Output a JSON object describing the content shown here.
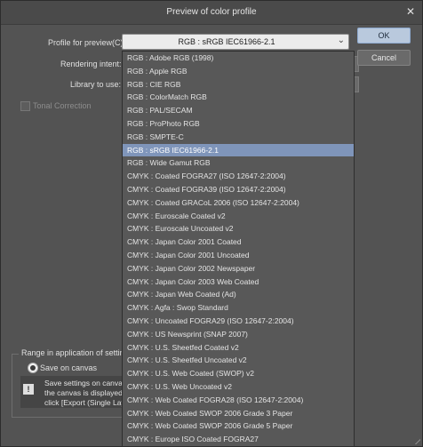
{
  "window": {
    "title": "Preview of color profile"
  },
  "form": {
    "profile_label": "Profile for preview(C):",
    "rendering_label": "Rendering intent:",
    "library_label": "Library to use:",
    "tonal_label": "Tonal Correction",
    "selected_profile": "RGB : sRGB IEC61966-2.1"
  },
  "buttons": {
    "ok": "OK",
    "cancel": "Cancel"
  },
  "range": {
    "title": "Range in application of settings",
    "radio_label": "Save on canvas",
    "info_lines": [
      "Save settings on canvas",
      "the canvas is displayed.",
      "click [Export (Single Laye"
    ]
  },
  "dropdown_options": [
    "RGB : Adobe RGB (1998)",
    "RGB : Apple RGB",
    "RGB : CIE RGB",
    "RGB : ColorMatch RGB",
    "RGB : PAL/SECAM",
    "RGB : ProPhoto RGB",
    "RGB : SMPTE-C",
    "RGB : sRGB IEC61966-2.1",
    "RGB : Wide Gamut RGB",
    "CMYK : Coated FOGRA27 (ISO 12647-2:2004)",
    "CMYK : Coated FOGRA39 (ISO 12647-2:2004)",
    "CMYK : Coated GRACoL 2006 (ISO 12647-2:2004)",
    "CMYK : Euroscale Coated v2",
    "CMYK : Euroscale Uncoated v2",
    "CMYK : Japan Color 2001 Coated",
    "CMYK : Japan Color 2001 Uncoated",
    "CMYK : Japan Color 2002 Newspaper",
    "CMYK : Japan Color 2003 Web Coated",
    "CMYK : Japan Web Coated (Ad)",
    "CMYK : Agfa : Swop Standard",
    "CMYK : Uncoated FOGRA29 (ISO 12647-2:2004)",
    "CMYK : US Newsprint (SNAP 2007)",
    "CMYK : U.S. Sheetfed Coated v2",
    "CMYK : U.S. Sheetfed Uncoated v2",
    "CMYK : U.S. Web Coated (SWOP) v2",
    "CMYK : U.S. Web Uncoated v2",
    "CMYK : Web Coated FOGRA28 (ISO 12647-2:2004)",
    "CMYK : Web Coated SWOP 2006 Grade 3 Paper",
    "CMYK : Web Coated SWOP 2006 Grade 5 Paper",
    "CMYK : Europe ISO Coated FOGRA27"
  ],
  "selected_index": 7,
  "colors": {
    "selection": "#7f95ba",
    "ok_button": "#b9c9dd",
    "dialog_bg": "#535353"
  },
  "icons": {
    "close": "close-icon",
    "dropdown_arrow": "chevron-down-icon",
    "info": "info-icon"
  }
}
